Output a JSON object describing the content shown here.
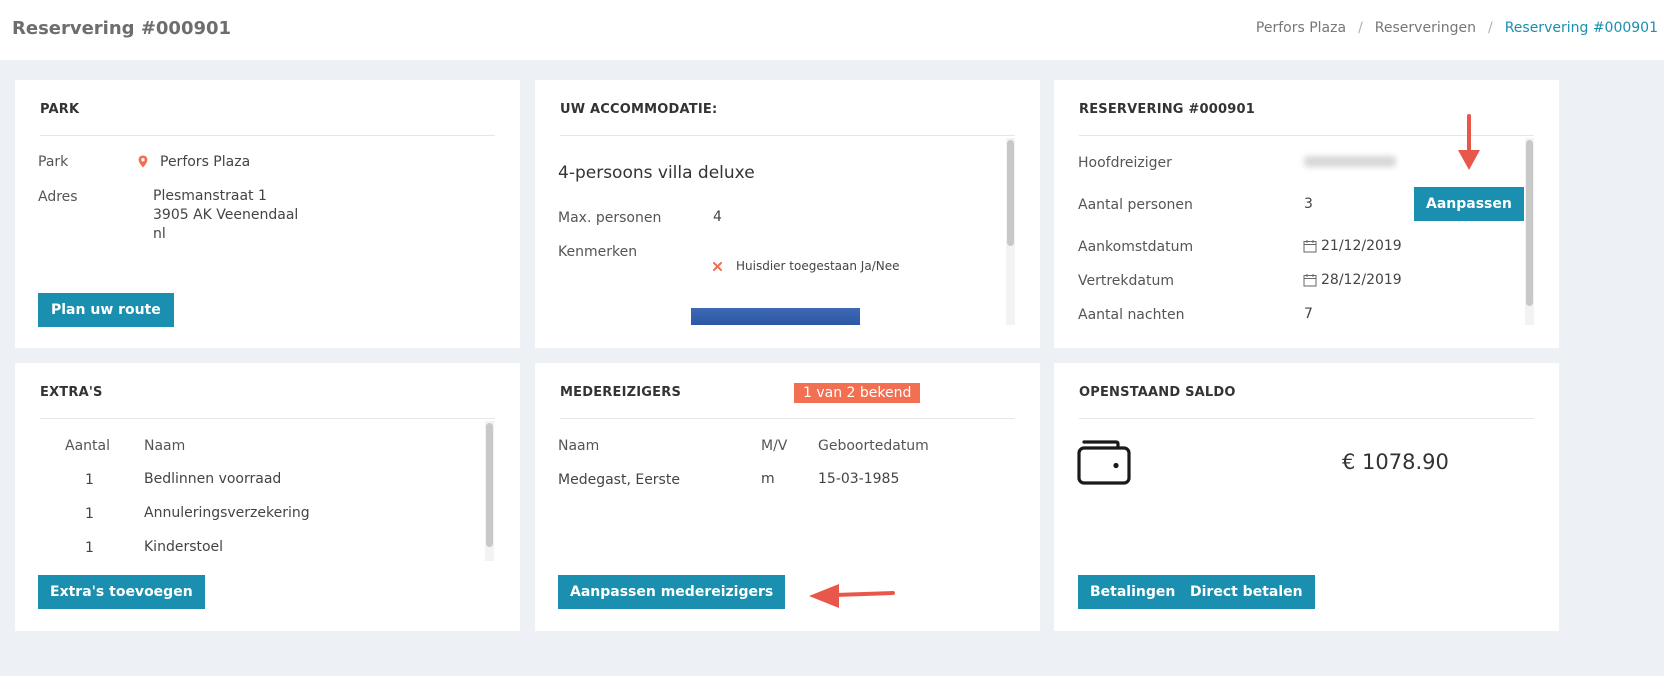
{
  "header": {
    "title": "Reservering #000901",
    "breadcrumb": [
      "Perfors Plaza",
      "Reserveringen",
      "Reservering #000901"
    ]
  },
  "park": {
    "heading": "PARK",
    "park_label": "Park",
    "park_value": "Perfors Plaza",
    "address_label": "Adres",
    "address_lines": [
      "Plesmanstraat 1",
      "3905 AK Veenendaal",
      "nl"
    ],
    "route_button": "Plan uw route"
  },
  "accommodation": {
    "heading": "UW ACCOMMODATIE:",
    "name": "4-persoons villa deluxe",
    "max_label": "Max. personen",
    "max_value": "4",
    "features_label": "Kenmerken",
    "feature": "Huisdier toegestaan Ja/Nee"
  },
  "reservation": {
    "heading": "RESERVERING #000901",
    "rows": [
      {
        "label": "Hoofdreiziger",
        "value": ""
      },
      {
        "label": "Aantal personen",
        "value": "3"
      },
      {
        "label": "Aankomstdatum",
        "value": "21/12/2019"
      },
      {
        "label": "Vertrekdatum",
        "value": "28/12/2019"
      },
      {
        "label": "Aantal nachten",
        "value": "7"
      }
    ],
    "edit_button": "Aanpassen"
  },
  "extras": {
    "heading": "EXTRA'S",
    "columns": [
      "Aantal",
      "Naam"
    ],
    "rows": [
      {
        "qty": "1",
        "name": "Bedlinnen voorraad"
      },
      {
        "qty": "1",
        "name": "Annuleringsverzekering"
      },
      {
        "qty": "1",
        "name": "Kinderstoel"
      }
    ],
    "add_button": "Extra's toevoegen"
  },
  "travelers": {
    "heading": "MEDEREIZIGERS",
    "badge": "1 van 2 bekend",
    "columns": [
      "Naam",
      "M/V",
      "Geboortedatum"
    ],
    "rows": [
      {
        "name": "Medegast, Eerste",
        "gender": "m",
        "birthdate": "15-03-1985"
      }
    ],
    "edit_button": "Aanpassen medereizigers"
  },
  "balance": {
    "heading": "OPENSTAAND SALDO",
    "amount": "€ 1078.90",
    "payments_button": "Betalingen",
    "pay_button": "Direct betalen"
  },
  "colors": {
    "accent": "#1a8fb0",
    "badge": "#f36f52",
    "arrow": "#e8574a"
  }
}
